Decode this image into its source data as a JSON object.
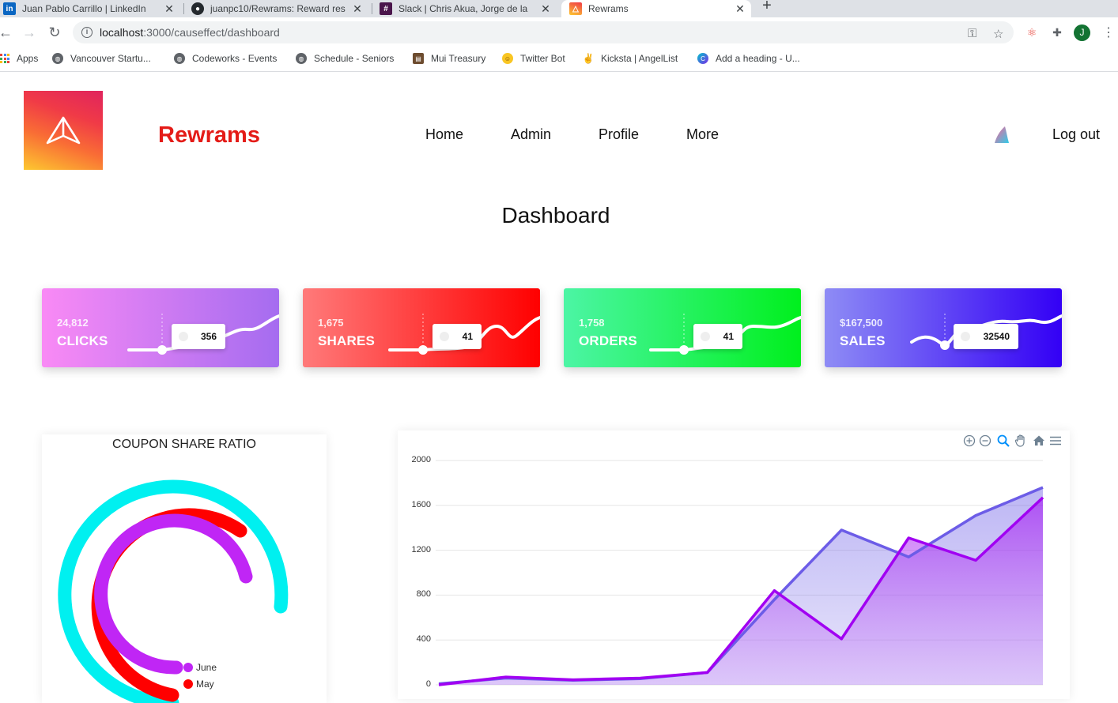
{
  "browser": {
    "tabs": [
      {
        "title": "Juan Pablo Carrillo | LinkedIn",
        "icon": "linkedin-icon",
        "color": "#0a66c2",
        "glyph": "in"
      },
      {
        "title": "juanpc10/Rewrams: Reward res",
        "icon": "github-icon",
        "color": "#24292e",
        "glyph": "●"
      },
      {
        "title": "Slack | Chris Akua, Jorge de la",
        "icon": "slack-icon",
        "color": "#4a154b",
        "glyph": "#"
      },
      {
        "title": "Rewrams",
        "icon": "rewrams-favicon",
        "color": "#f55a3c",
        "glyph": "△",
        "active": true
      }
    ],
    "url": {
      "host": "localhost",
      "path": ":3000/causeffect/dashboard"
    },
    "bookmarks": [
      {
        "label": "Apps",
        "icon": "apps-grid-icon"
      },
      {
        "label": "Vancouver Startu...",
        "icon": "globe-icon"
      },
      {
        "label": "Codeworks - Events",
        "icon": "globe-icon"
      },
      {
        "label": "Schedule - Seniors",
        "icon": "globe-icon"
      },
      {
        "label": "Mui Treasury",
        "icon": "treasure-chest-icon"
      },
      {
        "label": "Twitter Bot",
        "icon": "laughing-emoji-icon"
      },
      {
        "label": "Kicksta | AngelList",
        "icon": "victory-hand-icon"
      },
      {
        "label": "Add a heading - U...",
        "icon": "canva-icon"
      }
    ],
    "profile_initial": "J"
  },
  "header": {
    "brand": "Rewrams",
    "nav": [
      "Home",
      "Admin",
      "Profile",
      "More"
    ],
    "logout": "Log out"
  },
  "page": {
    "title": "Dashboard"
  },
  "stats": [
    {
      "value": "24,812",
      "label": "CLICKS",
      "tooltip": "356",
      "gradient": [
        "#f98af5",
        "#a56cf0"
      ]
    },
    {
      "value": "1,675",
      "label": "SHARES",
      "tooltip": "41",
      "gradient": [
        "#ff7a7a",
        "#ff0000"
      ]
    },
    {
      "value": "1,758",
      "label": "ORDERS",
      "tooltip": "41",
      "gradient": [
        "#4cf5a5",
        "#00f01d"
      ]
    },
    {
      "value": "$167,500",
      "label": "SALES",
      "tooltip": "32540",
      "gradient": [
        "#8e8cf5",
        "#3300f5"
      ]
    }
  ],
  "coupon": {
    "title": "COUPON SHARE RATIO",
    "legend": [
      "June",
      "May"
    ],
    "colors": [
      "#c026f5",
      "#ff0000",
      "#00f0f0"
    ]
  },
  "chart_data": {
    "type": "area",
    "y_ticks": [
      0,
      400,
      800,
      1200,
      1600,
      2000
    ],
    "ylim": [
      0,
      2000
    ],
    "grid": true,
    "series": [
      {
        "color": "#6c5ce7",
        "values": [
          10,
          60,
          40,
          55,
          110,
          760,
          1380,
          1140,
          1510,
          1760
        ]
      },
      {
        "color": "#a100f2",
        "values": [
          0,
          70,
          45,
          60,
          110,
          840,
          410,
          1310,
          1110,
          1670
        ]
      }
    ],
    "toolbar_icons": [
      "zoom-in-icon",
      "zoom-out-icon",
      "magnifier-icon",
      "pan-hand-icon",
      "home-icon",
      "menu-icon"
    ]
  }
}
